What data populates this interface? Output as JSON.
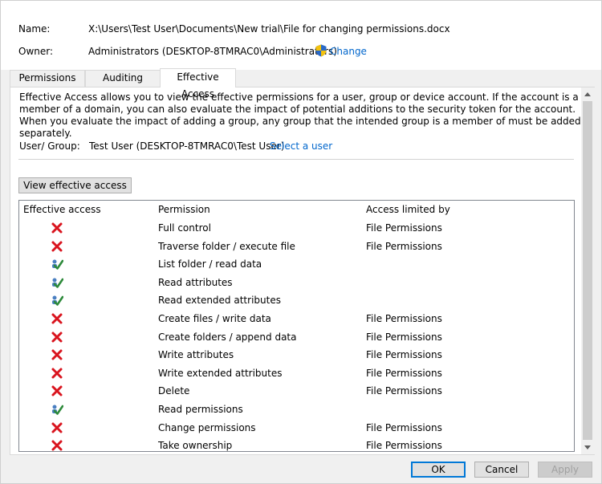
{
  "header": {
    "name_label": "Name:",
    "name_value": "X:\\Users\\Test User\\Documents\\New trial\\File for changing permissions.docx",
    "owner_label": "Owner:",
    "owner_value": "Administrators (DESKTOP-8TMRAC0\\Administrators)",
    "change_link": "Change",
    "shield_icon": "uac-shield-icon"
  },
  "tabs": [
    {
      "label": "Permissions",
      "active": false
    },
    {
      "label": "Auditing",
      "active": false
    },
    {
      "label": "Effective Access",
      "active": true
    }
  ],
  "panel": {
    "description": "Effective Access allows you to view the effective permissions for a user, group or device account. If the account is a member of a domain, you can also evaluate the impact of potential additions to the security token for the account. When you evaluate the impact of adding a group, any group that the intended group is a member of must be added separately.",
    "user_group_label": "User/ Group:",
    "user_group_value": "Test User (DESKTOP-8TMRAC0\\Test User)",
    "select_user_link": "Select a user",
    "view_button": "View effective access"
  },
  "table": {
    "columns": [
      "Effective access",
      "Permission",
      "Access limited by"
    ],
    "rows": [
      {
        "icon": "denied-x-icon",
        "permission": "Full control",
        "limited_by": "File Permissions"
      },
      {
        "icon": "denied-x-icon",
        "permission": "Traverse folder / execute file",
        "limited_by": "File Permissions"
      },
      {
        "icon": "allowed-check-icon",
        "permission": "List folder / read data",
        "limited_by": ""
      },
      {
        "icon": "allowed-check-icon",
        "permission": "Read attributes",
        "limited_by": ""
      },
      {
        "icon": "allowed-check-icon",
        "permission": "Read extended attributes",
        "limited_by": ""
      },
      {
        "icon": "denied-x-icon",
        "permission": "Create files / write data",
        "limited_by": "File Permissions"
      },
      {
        "icon": "denied-x-icon",
        "permission": "Create folders / append data",
        "limited_by": "File Permissions"
      },
      {
        "icon": "denied-x-icon",
        "permission": "Write attributes",
        "limited_by": "File Permissions"
      },
      {
        "icon": "denied-x-icon",
        "permission": "Write extended attributes",
        "limited_by": "File Permissions"
      },
      {
        "icon": "denied-x-icon",
        "permission": "Delete",
        "limited_by": "File Permissions"
      },
      {
        "icon": "allowed-check-icon",
        "permission": "Read permissions",
        "limited_by": ""
      },
      {
        "icon": "denied-x-icon",
        "permission": "Change permissions",
        "limited_by": "File Permissions"
      },
      {
        "icon": "denied-x-icon",
        "permission": "Take ownership",
        "limited_by": "File Permissions"
      }
    ]
  },
  "footer": {
    "ok": "OK",
    "cancel": "Cancel",
    "apply": "Apply"
  },
  "colors": {
    "link": "#0066cc",
    "deny": "#d9141e",
    "allow": "#2d8a3a",
    "focus": "#0078d7"
  }
}
